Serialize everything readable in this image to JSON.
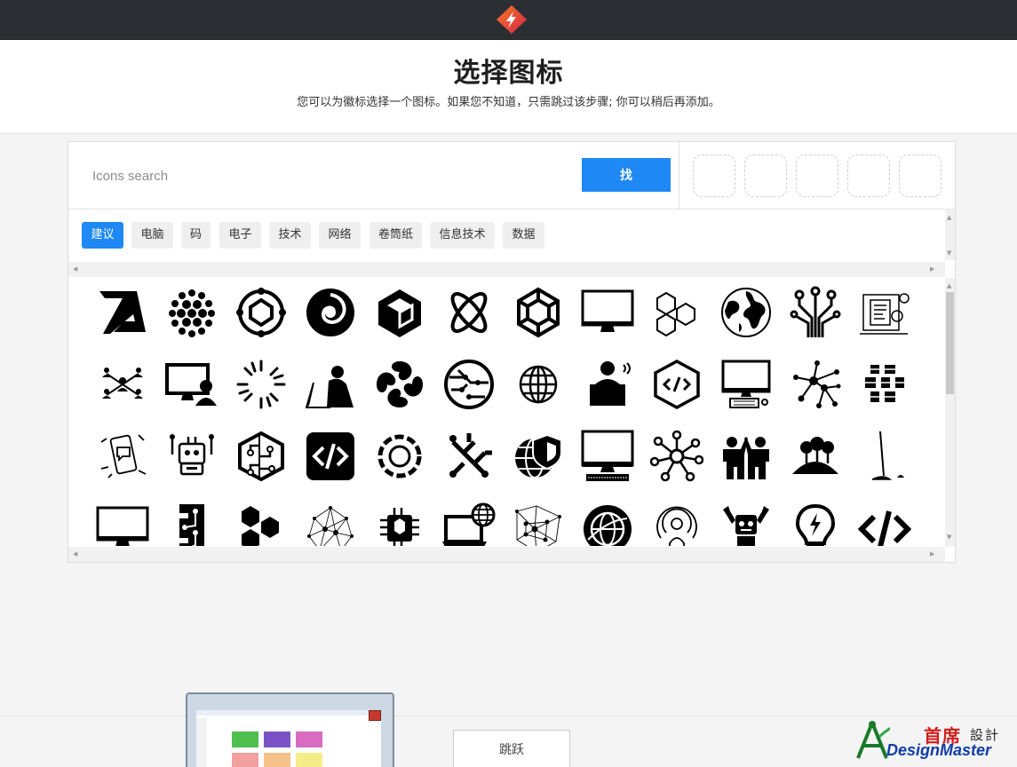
{
  "header": {
    "title": "选择图标",
    "subtitle": "您可以为徽标选择一个图标。如果您不知道，只需跳过该步骤; 你可以稍后再添加。"
  },
  "search": {
    "placeholder": "Icons search",
    "value": "",
    "button_label": "找"
  },
  "selected_slots": [
    "empty",
    "empty",
    "empty",
    "empty",
    "empty"
  ],
  "tags": [
    {
      "label": "建议",
      "active": true
    },
    {
      "label": "电脑",
      "active": false
    },
    {
      "label": "码",
      "active": false
    },
    {
      "label": "电子",
      "active": false
    },
    {
      "label": "技术",
      "active": false
    },
    {
      "label": "网络",
      "active": false
    },
    {
      "label": "卷筒纸",
      "active": false
    },
    {
      "label": "信息技术",
      "active": false
    },
    {
      "label": "数据",
      "active": false
    }
  ],
  "icons": [
    [
      "z-letter-icon",
      "dotted-sphere-icon",
      "circuit-ring-icon",
      "spiral-swirl-icon",
      "hexagon-cube-icon",
      "atom-orbit-icon",
      "hexagon-knot-icon",
      "monitor-icon",
      "hexagons-cluster-icon",
      "globe-world-icon",
      "circuit-lines-icon",
      "document-gears-icon"
    ],
    [
      "people-network-icon",
      "desktop-user-icon",
      "loading-burst-icon",
      "person-laptop-icon",
      "four-petal-icon",
      "circuit-circle-icon",
      "globe-grid-icon",
      "laptop-worker-icon",
      "hexagon-code-icon",
      "desktop-computer-icon",
      "node-network-icon",
      "cube-pattern-icon"
    ],
    [
      "phone-chat-icon",
      "robot-tools-icon",
      "hexagon-circuit-icon",
      "code-box-icon",
      "ring-chain-icon",
      "circuit-square-icon",
      "globe-shield-icon",
      "imac-keyboard-icon",
      "hub-network-icon",
      "people-highfive-icon",
      "tree-hill-icon",
      "imac-side-icon"
    ],
    [
      "monitor-wide-icon",
      "circuit-board-icon",
      "hexagons-honeycomb-icon",
      "mesh-network-icon",
      "microchip-icon",
      "laptop-globe-icon",
      "mesh-web-icon",
      "globe-orbit-icon",
      "podcast-person-icon",
      "robot-wrench-icon",
      "lightbulb-bolt-icon",
      "code-brackets-icon"
    ]
  ],
  "footer": {
    "skip_label": "跳跃"
  },
  "watermark": {
    "cn_primary": "首席",
    "cn_secondary": "設計",
    "en": "DesignMaster"
  },
  "colors": {
    "accent": "#1e88f5",
    "topbar": "#2b2f33",
    "logo_red": "#e8334a",
    "logo_orange": "#f47a2b"
  }
}
